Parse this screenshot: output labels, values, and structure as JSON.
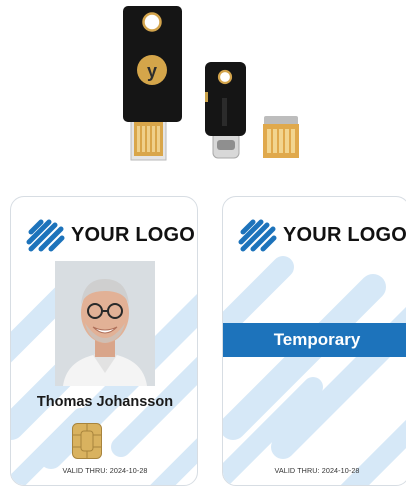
{
  "keys": {
    "large_key_letter": "y"
  },
  "cards": [
    {
      "logo_text": "YOUR LOGO",
      "person_name": "Thomas Johansson",
      "valid_thru": "VALID THRU: 2024-10-28"
    },
    {
      "logo_text": "YOUR LOGO",
      "banner_text": "Temporary",
      "valid_thru": "VALID THRU: 2024-10-28"
    }
  ],
  "colors": {
    "brand_blue": "#1d73bb",
    "pattern_blue": "#d6e8f7",
    "key_black": "#111111",
    "key_gold": "#c9a24a"
  }
}
